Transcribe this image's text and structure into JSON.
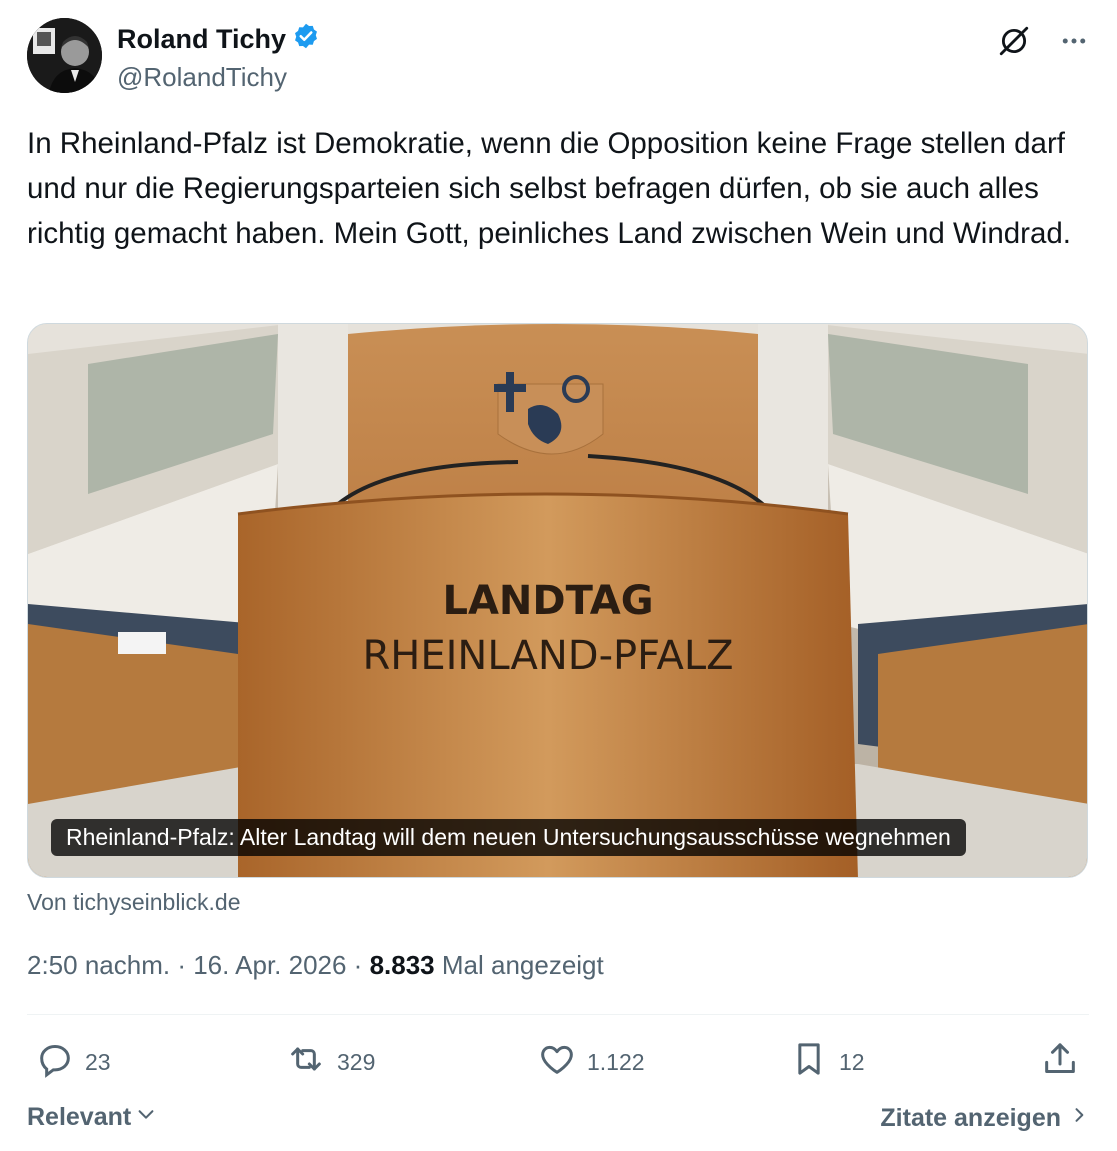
{
  "author": {
    "display_name": "Roland Tichy",
    "handle": "@RolandTichy",
    "verified_icon": "verified-badge-icon",
    "verified_color": "#1d9bf0"
  },
  "header_actions": {
    "grok_icon": "grok-icon",
    "more_icon": "more-icon"
  },
  "tweet": {
    "text": "In Rheinland-Pfalz ist Demokratie, wenn die Opposition keine Frage stellen darf und nur die Regierungsparteien sich selbst befragen dürfen, ob sie auch alles richtig gemacht haben. Mein Gott, peinliches Land zwischen Wein und Windrad."
  },
  "card": {
    "image_sign_line1": "LANDTAG",
    "image_sign_line2": "RHEINLAND-PFALZ",
    "caption": "Rheinland-Pfalz: Alter Landtag will dem neuen Untersuchungsausschüsse wegnehmen",
    "source": "Von tichyseinblick.de"
  },
  "meta": {
    "time": "2:50 nachm.",
    "sep1": " · ",
    "date": "16. Apr. 2026",
    "sep2": " · ",
    "views_count": "8.833",
    "views_label": " Mal angezeigt"
  },
  "actions": {
    "replies": "23",
    "reposts": "329",
    "likes": "1.122",
    "bookmarks": "12",
    "reply_icon": "reply-icon",
    "repost_icon": "repost-icon",
    "like_icon": "heart-icon",
    "bookmark_icon": "bookmark-icon",
    "share_icon": "share-icon"
  },
  "footer": {
    "sort_label": "Relevant",
    "quotes_label": "Zitate anzeigen"
  },
  "colors": {
    "text_primary": "#0f1419",
    "text_secondary": "#536471",
    "accent": "#1d9bf0"
  }
}
